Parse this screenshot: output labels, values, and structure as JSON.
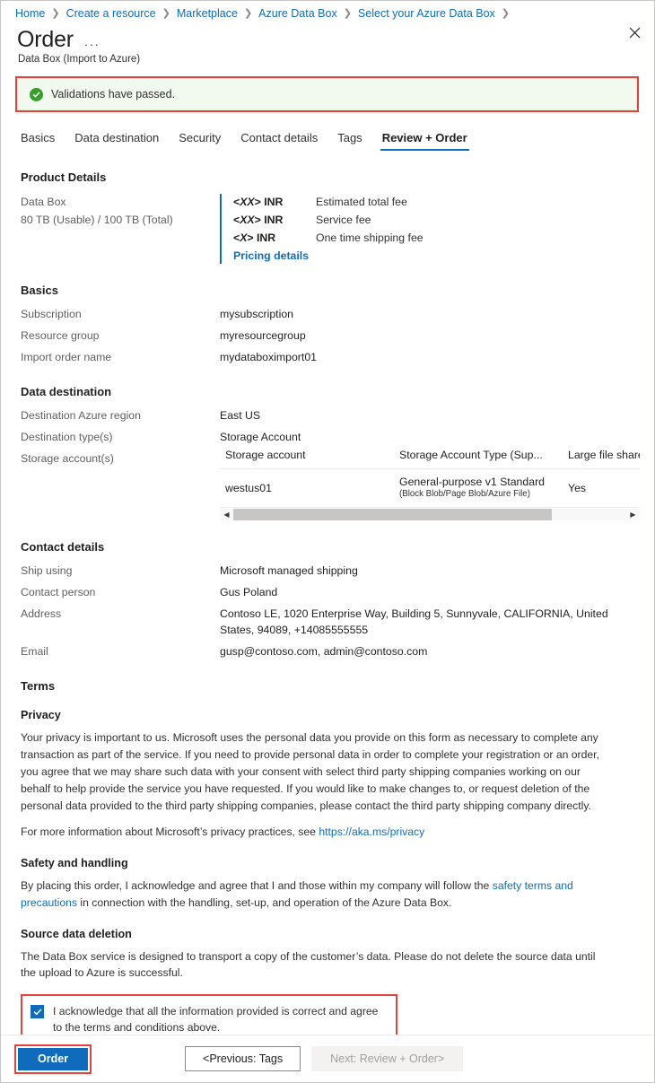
{
  "breadcrumb": [
    "Home",
    "Create a resource",
    "Marketplace",
    "Azure Data Box",
    "Select your Azure Data Box"
  ],
  "header": {
    "title": "Order",
    "ellipsis": "···",
    "subtitle": "Data Box (Import to Azure)",
    "close_icon": "close-icon"
  },
  "banner": {
    "icon": "success-check-icon",
    "text": "Validations have passed.",
    "background": "#f2faef",
    "icon_color": "#37a02c",
    "highlight_color": "#e8403a"
  },
  "tabs": [
    {
      "label": "Basics",
      "active": false
    },
    {
      "label": "Data destination",
      "active": false
    },
    {
      "label": "Security",
      "active": false
    },
    {
      "label": "Contact details",
      "active": false
    },
    {
      "label": "Tags",
      "active": false
    },
    {
      "label": "Review + Order",
      "active": true
    }
  ],
  "product_details": {
    "heading": "Product Details",
    "name": "Data Box",
    "capacity": "80 TB (Usable) / 100 TB (Total)",
    "prices": [
      {
        "amount_prefix": "<",
        "amount_var": "XX",
        "amount_suffix": "> INR",
        "label": "Estimated total fee"
      },
      {
        "amount_prefix": "<",
        "amount_var": "XX",
        "amount_suffix": "> INR",
        "label": "Service fee"
      },
      {
        "amount_prefix": "<",
        "amount_var": "X",
        "amount_suffix": "> INR",
        "label": "One time shipping fee"
      }
    ],
    "pricing_link": "Pricing details",
    "accent_color": "#0f6cbd"
  },
  "basics": {
    "heading": "Basics",
    "rows": [
      {
        "label": "Subscription",
        "value": "mysubscription"
      },
      {
        "label": "Resource group",
        "value": "myresourcegroup"
      },
      {
        "label": "Import order name",
        "value": "mydataboximport01"
      }
    ]
  },
  "data_destination": {
    "heading": "Data destination",
    "rows": [
      {
        "label": "Destination Azure region",
        "value": "East US"
      },
      {
        "label": "Destination type(s)",
        "value": "Storage Account"
      }
    ],
    "storage_label": "Storage account(s)",
    "table": {
      "columns": [
        "Storage account",
        "Storage Account Type (Sup...",
        "Large file shares ena"
      ],
      "rows": [
        {
          "account": "westus01",
          "type": "General-purpose v1 Standard",
          "type_sub": "(Block Blob/Page Blob/Azure File)",
          "large_file_shares": "Yes"
        }
      ],
      "scroll_left_icon": "triangle-left-icon",
      "scroll_right_icon": "triangle-right-icon"
    }
  },
  "contact_details": {
    "heading": "Contact details",
    "rows": [
      {
        "label": "Ship using",
        "value": "Microsoft managed shipping"
      },
      {
        "label": "Contact person",
        "value": "Gus Poland"
      },
      {
        "label": "Address",
        "value": "Contoso LE, 1020 Enterprise Way, Building 5, Sunnyvale, CALIFORNIA, United States, 94089, +14085555555"
      },
      {
        "label": "Email",
        "value": "gusp@contoso.com, admin@contoso.com"
      }
    ]
  },
  "terms": {
    "heading": "Terms",
    "privacy": {
      "heading": "Privacy",
      "paragraph": "Your privacy is important to us. Microsoft uses the personal data you provide on this form as necessary to complete any transaction as part of the service. If you need to provide personal data in order to complete your registration or an order, you agree that we may share such data with your consent with select third party shipping companies working on our behalf to help provide the service you have requested. If you would like to make changes to, or request deletion of the personal data provided to the third party shipping companies, please contact the third party shipping company directly.",
      "more_info_prefix": "For more information about Microsoft’s privacy practices, see ",
      "more_info_link": "https://aka.ms/privacy"
    },
    "safety": {
      "heading": "Safety and handling",
      "text_before_link": "By placing this order, I acknowledge and agree that I and those within my company will follow the ",
      "link_text": "safety terms and precautions",
      "text_after_link": " in connection with the handling, set-up, and operation of the Azure Data Box."
    },
    "source_deletion": {
      "heading": "Source data deletion",
      "paragraph": "The Data Box service is designed to transport a copy of the customer’s data. Please do not delete the source data until the upload to Azure is successful."
    }
  },
  "acknowledgement": {
    "checked": true,
    "text": "I acknowledge that all the information provided is correct and agree to the terms and conditions above.",
    "highlight_color": "#e8403a",
    "checkbox_color": "#0f6cbd"
  },
  "footer": {
    "order_label": "Order",
    "previous_label": "<Previous: Tags",
    "next_label": "Next: Review + Order>",
    "next_disabled": true,
    "order_highlight_color": "#e8403a"
  }
}
